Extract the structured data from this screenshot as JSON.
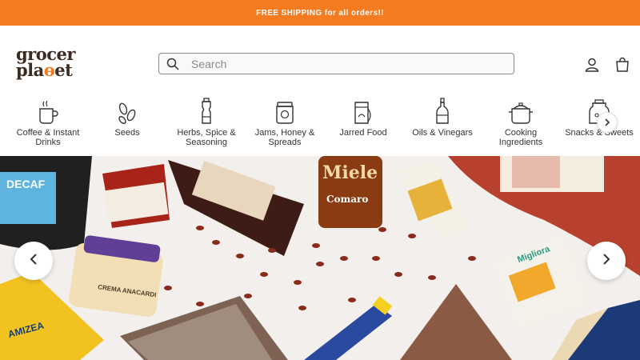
{
  "announcement": {
    "text": "FREE SHIPPING for all orders!!"
  },
  "logo": {
    "line1": "grocer",
    "line2_a": "pla",
    "line2_b": "et"
  },
  "search": {
    "placeholder": "Search"
  },
  "header_icons": {
    "account": "user-icon",
    "cart": "bag-icon"
  },
  "categories": [
    {
      "label": "Coffee & Instant Drinks",
      "icon": "coffee-cup-icon"
    },
    {
      "label": "Seeds",
      "icon": "seeds-icon"
    },
    {
      "label": "Herbs, Spice & Seasoning",
      "icon": "pepper-mill-icon"
    },
    {
      "label": "Jams, Honey & Spreads",
      "icon": "jam-jar-icon"
    },
    {
      "label": "Jarred Food",
      "icon": "jar-icon"
    },
    {
      "label": "Oils & Vinegars",
      "icon": "bottle-icon"
    },
    {
      "label": "Cooking Ingredients",
      "icon": "pot-icon"
    },
    {
      "label": "Snacks & Sweets",
      "icon": "snack-jar-icon"
    }
  ],
  "hero": {
    "products": {
      "decaf": "DECAF",
      "miele": "Miele",
      "comaro": "Comaro",
      "crema": "CREMA ANACARDI",
      "migliora": "Migliora",
      "amizea": "AMIZEA"
    },
    "prev_icon": "chevron-left-icon",
    "next_icon": "chevron-right-icon"
  },
  "colors": {
    "accent": "#f47b20",
    "logo": "#3a2a20"
  }
}
